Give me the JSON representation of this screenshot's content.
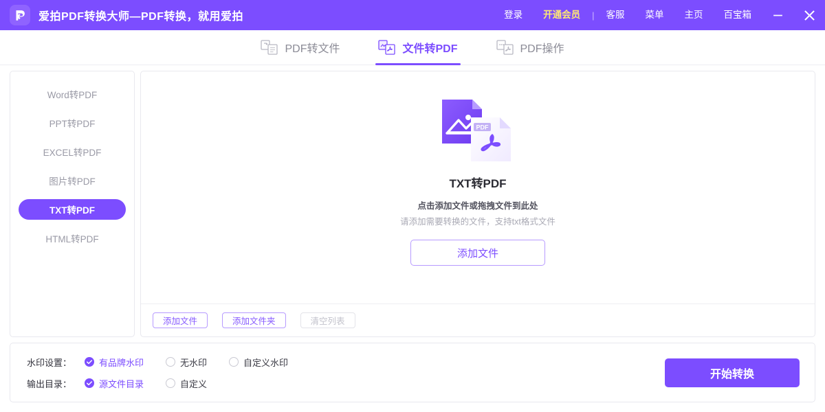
{
  "header": {
    "logo_icon": "app-logo-p-arrow",
    "title": "爱拍PDF转换大师—PDF转换，就用爱拍",
    "brand_color": "#7c4dff",
    "vip_color": "#ffe873",
    "links": [
      {
        "label": "登录",
        "name": "login",
        "style": "normal"
      },
      {
        "label": "开通会员",
        "name": "open-vip",
        "style": "vip"
      },
      {
        "label": "客服",
        "name": "customer-service",
        "style": "normal"
      },
      {
        "label": "菜单",
        "name": "menu",
        "style": "normal"
      },
      {
        "label": "主页",
        "name": "home",
        "style": "normal"
      },
      {
        "label": "百宝箱",
        "name": "toolbox",
        "style": "normal"
      }
    ],
    "separator": "|",
    "minimize_icon": "minimize-icon",
    "close_icon": "close-icon"
  },
  "tabs": [
    {
      "label": "PDF转文件",
      "name": "pdf-to-file",
      "active": false
    },
    {
      "label": "文件转PDF",
      "name": "file-to-pdf",
      "active": true
    },
    {
      "label": "PDF操作",
      "name": "pdf-operations",
      "active": false
    }
  ],
  "sidebar": {
    "items": [
      {
        "label": "Word转PDF",
        "name": "word-to-pdf",
        "active": false
      },
      {
        "label": "PPT转PDF",
        "name": "ppt-to-pdf",
        "active": false
      },
      {
        "label": "EXCEL转PDF",
        "name": "excel-to-pdf",
        "active": false
      },
      {
        "label": "图片转PDF",
        "name": "image-to-pdf",
        "active": false
      },
      {
        "label": "TXT转PDF",
        "name": "txt-to-pdf",
        "active": true
      },
      {
        "label": "HTML转PDF",
        "name": "html-to-pdf",
        "active": false
      }
    ]
  },
  "drop_area": {
    "illustration_icon": "image-to-pdf-illustration",
    "title": "TXT转PDF",
    "subtitle": "点击添加文件或拖拽文件到此处",
    "hint": "请添加需要转换的文件，支持txt格式文件",
    "add_button": "添加文件"
  },
  "main_footer": {
    "buttons": [
      {
        "label": "添加文件",
        "name": "add-file",
        "disabled": false
      },
      {
        "label": "添加文件夹",
        "name": "add-folder",
        "disabled": false
      },
      {
        "label": "清空列表",
        "name": "clear-list",
        "disabled": true
      }
    ]
  },
  "settings": {
    "watermark": {
      "label": "水印设置：",
      "options": [
        {
          "label": "有品牌水印",
          "name": "brand-watermark",
          "checked": true
        },
        {
          "label": "无水印",
          "name": "no-watermark",
          "checked": false
        },
        {
          "label": "自定义水印",
          "name": "custom-watermark",
          "checked": false
        }
      ]
    },
    "output": {
      "label": "输出目录：",
      "options": [
        {
          "label": "源文件目录",
          "name": "source-dir",
          "checked": true
        },
        {
          "label": "自定义",
          "name": "custom-dir",
          "checked": false
        }
      ]
    },
    "start_button": "开始转换"
  }
}
